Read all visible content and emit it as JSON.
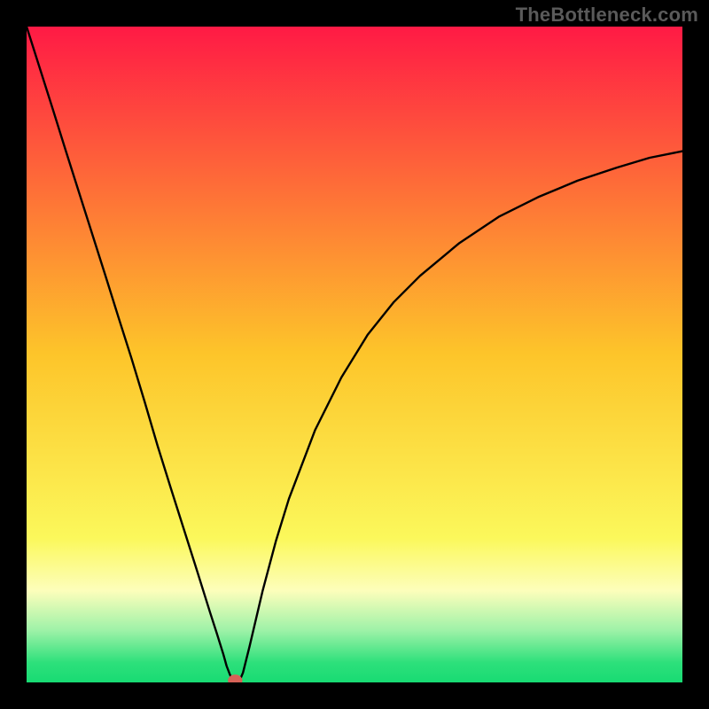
{
  "watermark": "TheBottleneck.com",
  "chart_data": {
    "type": "line",
    "title": "",
    "xlabel": "",
    "ylabel": "",
    "xlim": [
      0,
      100
    ],
    "ylim": [
      0,
      100
    ],
    "background_gradient": {
      "stops": [
        {
          "offset": 0.0,
          "color": "#ff1a45"
        },
        {
          "offset": 0.5,
          "color": "#fdc52a"
        },
        {
          "offset": 0.78,
          "color": "#fbf85b"
        },
        {
          "offset": 0.86,
          "color": "#fdfebb"
        },
        {
          "offset": 0.92,
          "color": "#9ff2a8"
        },
        {
          "offset": 0.97,
          "color": "#2de07b"
        },
        {
          "offset": 1.0,
          "color": "#18db73"
        }
      ]
    },
    "series": [
      {
        "name": "curve",
        "x": [
          0.0,
          2.0,
          4.0,
          6.0,
          8.0,
          10.0,
          12.0,
          14.0,
          16.0,
          18.0,
          20.0,
          22.0,
          24.0,
          26.0,
          28.0,
          29.0,
          30.0,
          30.5,
          31.0,
          31.3,
          31.7,
          32.0,
          32.5,
          33.0,
          34.0,
          36.0,
          38.0,
          40.0,
          44.0,
          48.0,
          52.0,
          56.0,
          60.0,
          66.0,
          72.0,
          78.0,
          84.0,
          90.0,
          95.0,
          100.0
        ],
        "values": [
          100.0,
          93.7,
          87.4,
          81.0,
          74.7,
          68.4,
          62.1,
          55.7,
          49.4,
          42.8,
          36.0,
          29.6,
          23.3,
          17.0,
          10.6,
          7.5,
          4.3,
          2.5,
          1.2,
          0.6,
          0.3,
          0.3,
          0.3,
          1.5,
          5.5,
          14.0,
          21.5,
          28.0,
          38.5,
          46.5,
          53.0,
          58.0,
          62.0,
          67.0,
          71.0,
          74.0,
          76.5,
          78.5,
          80.0,
          81.0
        ]
      }
    ],
    "marker": {
      "x": 31.8,
      "y": 0.3,
      "color": "#d66257",
      "rx": 1.1,
      "ry": 0.9
    }
  }
}
